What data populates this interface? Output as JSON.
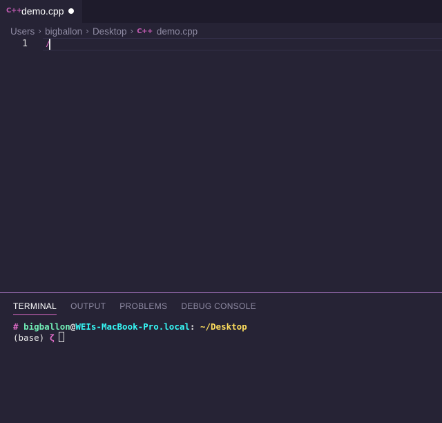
{
  "tabs": [
    {
      "icon": "C++",
      "label": "demo.cpp",
      "modified": true
    }
  ],
  "breadcrumb": {
    "parts": [
      "Users",
      "bigballon",
      "Desktop"
    ],
    "file_icon": "C++",
    "file": "demo.cpp"
  },
  "editor": {
    "line_number": "1",
    "code": "/"
  },
  "panel": {
    "tabs": [
      "TERMINAL",
      "OUTPUT",
      "PROBLEMS",
      "DEBUG CONSOLE"
    ],
    "active_tab": "TERMINAL"
  },
  "terminal": {
    "hash": "#",
    "user": "bigballon",
    "at": "@",
    "host": "WEIs-MacBook-Pro.local",
    "colon": ":",
    "path": "~/Desktop",
    "env": "(base)",
    "prompt": "ζ"
  },
  "colors": {
    "background": "#262335",
    "accent": "#e06cc8",
    "user_green": "#72f1b8",
    "host_cyan": "#36f9f6",
    "path_yellow": "#fede5d"
  },
  "icons": {
    "file_icon": "cpp-file-icon",
    "modified_indicator": "dirty-dot-icon",
    "separator": "chevron-right-icon"
  }
}
